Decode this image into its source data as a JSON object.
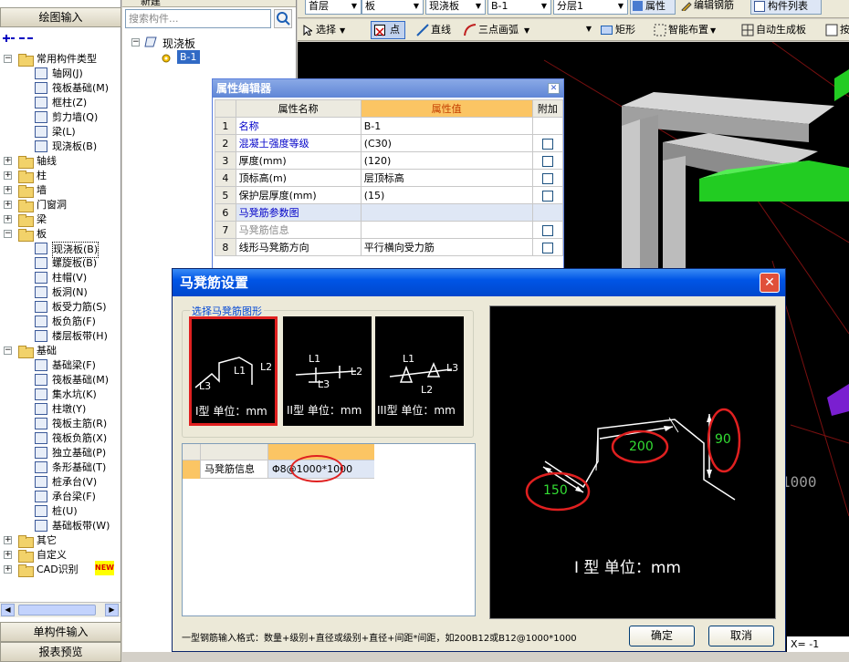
{
  "left_panel": {
    "header": "绘图输入",
    "footer_1": "单构件输入",
    "footer_2": "报表预览",
    "tree": [
      {
        "label": "常用构件类型",
        "level": 0,
        "expanded": true
      },
      {
        "label": "轴网(J)",
        "level": 1
      },
      {
        "label": "筏板基础(M)",
        "level": 1
      },
      {
        "label": "框柱(Z)",
        "level": 1
      },
      {
        "label": "剪力墙(Q)",
        "level": 1
      },
      {
        "label": "梁(L)",
        "level": 1
      },
      {
        "label": "现浇板(B)",
        "level": 1
      },
      {
        "label": "轴线",
        "level": 0
      },
      {
        "label": "柱",
        "level": 0
      },
      {
        "label": "墙",
        "level": 0
      },
      {
        "label": "门窗洞",
        "level": 0
      },
      {
        "label": "梁",
        "level": 0
      },
      {
        "label": "板",
        "level": 0,
        "expanded": true
      },
      {
        "label": "现浇板(B)",
        "level": 1,
        "selected": true
      },
      {
        "label": "螺旋板(B)",
        "level": 1
      },
      {
        "label": "柱帽(V)",
        "level": 1
      },
      {
        "label": "板洞(N)",
        "level": 1
      },
      {
        "label": "板受力筋(S)",
        "level": 1
      },
      {
        "label": "板负筋(F)",
        "level": 1
      },
      {
        "label": "楼层板带(H)",
        "level": 1
      },
      {
        "label": "基础",
        "level": 0,
        "expanded": true
      },
      {
        "label": "基础梁(F)",
        "level": 1
      },
      {
        "label": "筏板基础(M)",
        "level": 1
      },
      {
        "label": "集水坑(K)",
        "level": 1
      },
      {
        "label": "柱墩(Y)",
        "level": 1
      },
      {
        "label": "筏板主筋(R)",
        "level": 1
      },
      {
        "label": "筏板负筋(X)",
        "level": 1
      },
      {
        "label": "独立基础(P)",
        "level": 1
      },
      {
        "label": "条形基础(T)",
        "level": 1
      },
      {
        "label": "桩承台(V)",
        "level": 1
      },
      {
        "label": "承台梁(F)",
        "level": 1
      },
      {
        "label": "桩(U)",
        "level": 1
      },
      {
        "label": "基础板带(W)",
        "level": 1
      },
      {
        "label": "其它",
        "level": 0
      },
      {
        "label": "自定义",
        "level": 0
      },
      {
        "label": "CAD识别",
        "level": 0,
        "badge": "NEW"
      }
    ]
  },
  "comp_panel": {
    "toolbar_new": "新建",
    "search_placeholder": "搜索构件...",
    "tree_root": "现浇板",
    "tree_child": "B-1"
  },
  "toolbar": {
    "floor": "首层",
    "category": "板",
    "type": "现浇板",
    "component": "B-1",
    "layer": "分层1",
    "btn_property": "属性",
    "btn_edit_rebar": "编辑钢筋",
    "btn_component_list": "构件列表",
    "btn_select": "选择",
    "btn_point": "点",
    "btn_line": "直线",
    "btn_arc": "三点画弧",
    "btn_rect": "矩形",
    "btn_smart": "智能布置",
    "btn_auto": "自动生成板",
    "btn_more": "按"
  },
  "viewport": {
    "number_text": "1000",
    "coord_text": "X= -1"
  },
  "property_editor": {
    "title": "属性编辑器",
    "col_name": "属性名称",
    "col_value": "属性值",
    "col_extra": "附加",
    "rows": [
      {
        "no": "1",
        "name": "名称",
        "value": "B-1",
        "style": "blue",
        "check": false
      },
      {
        "no": "2",
        "name": "混凝土强度等级",
        "value": "(C30)",
        "style": "blue",
        "check": true
      },
      {
        "no": "3",
        "name": "厚度(mm)",
        "value": "(120)",
        "style": "",
        "check": true
      },
      {
        "no": "4",
        "name": "顶标高(m)",
        "value": "层顶标高",
        "style": "",
        "check": true
      },
      {
        "no": "5",
        "name": "保护层厚度(mm)",
        "value": "(15)",
        "style": "",
        "check": true
      },
      {
        "no": "6",
        "name": "马凳筋参数图",
        "value": "",
        "style": "blue",
        "check": false
      },
      {
        "no": "7",
        "name": "马凳筋信息",
        "value": "",
        "style": "gray",
        "check": true
      },
      {
        "no": "8",
        "name": "线形马凳筋方向",
        "value": "平行横向受力筋",
        "style": "",
        "check": true
      }
    ]
  },
  "dialog": {
    "title": "马凳筋设置",
    "group_label": "选择马凳筋图形",
    "shapes": [
      {
        "caption": "I型 单位：mm",
        "l1": "L1",
        "l2": "L2",
        "l3": "L3"
      },
      {
        "caption": "II型 单位：mm",
        "l1": "L1",
        "l2": "L2",
        "l3": "L3"
      },
      {
        "caption": "III型 单位：mm",
        "l1": "L1",
        "l2": "L2",
        "l3": "L3"
      }
    ],
    "grid_row_label": "马凳筋信息",
    "grid_value": "Φ8@1000*1000",
    "preview": {
      "caption": "I 型  单位：mm",
      "dim_l1": "200",
      "dim_l2": "90",
      "dim_l3": "150"
    },
    "hint": "一型钢筋输入格式：数量+级别+直径或级别+直径+间距*间距，如200B12或B12@1000*1000",
    "ok": "确定",
    "cancel": "取消"
  },
  "colors": {
    "accent": "#0055e6",
    "highlight_red": "#e02020",
    "green_dim": "#33dd33"
  }
}
